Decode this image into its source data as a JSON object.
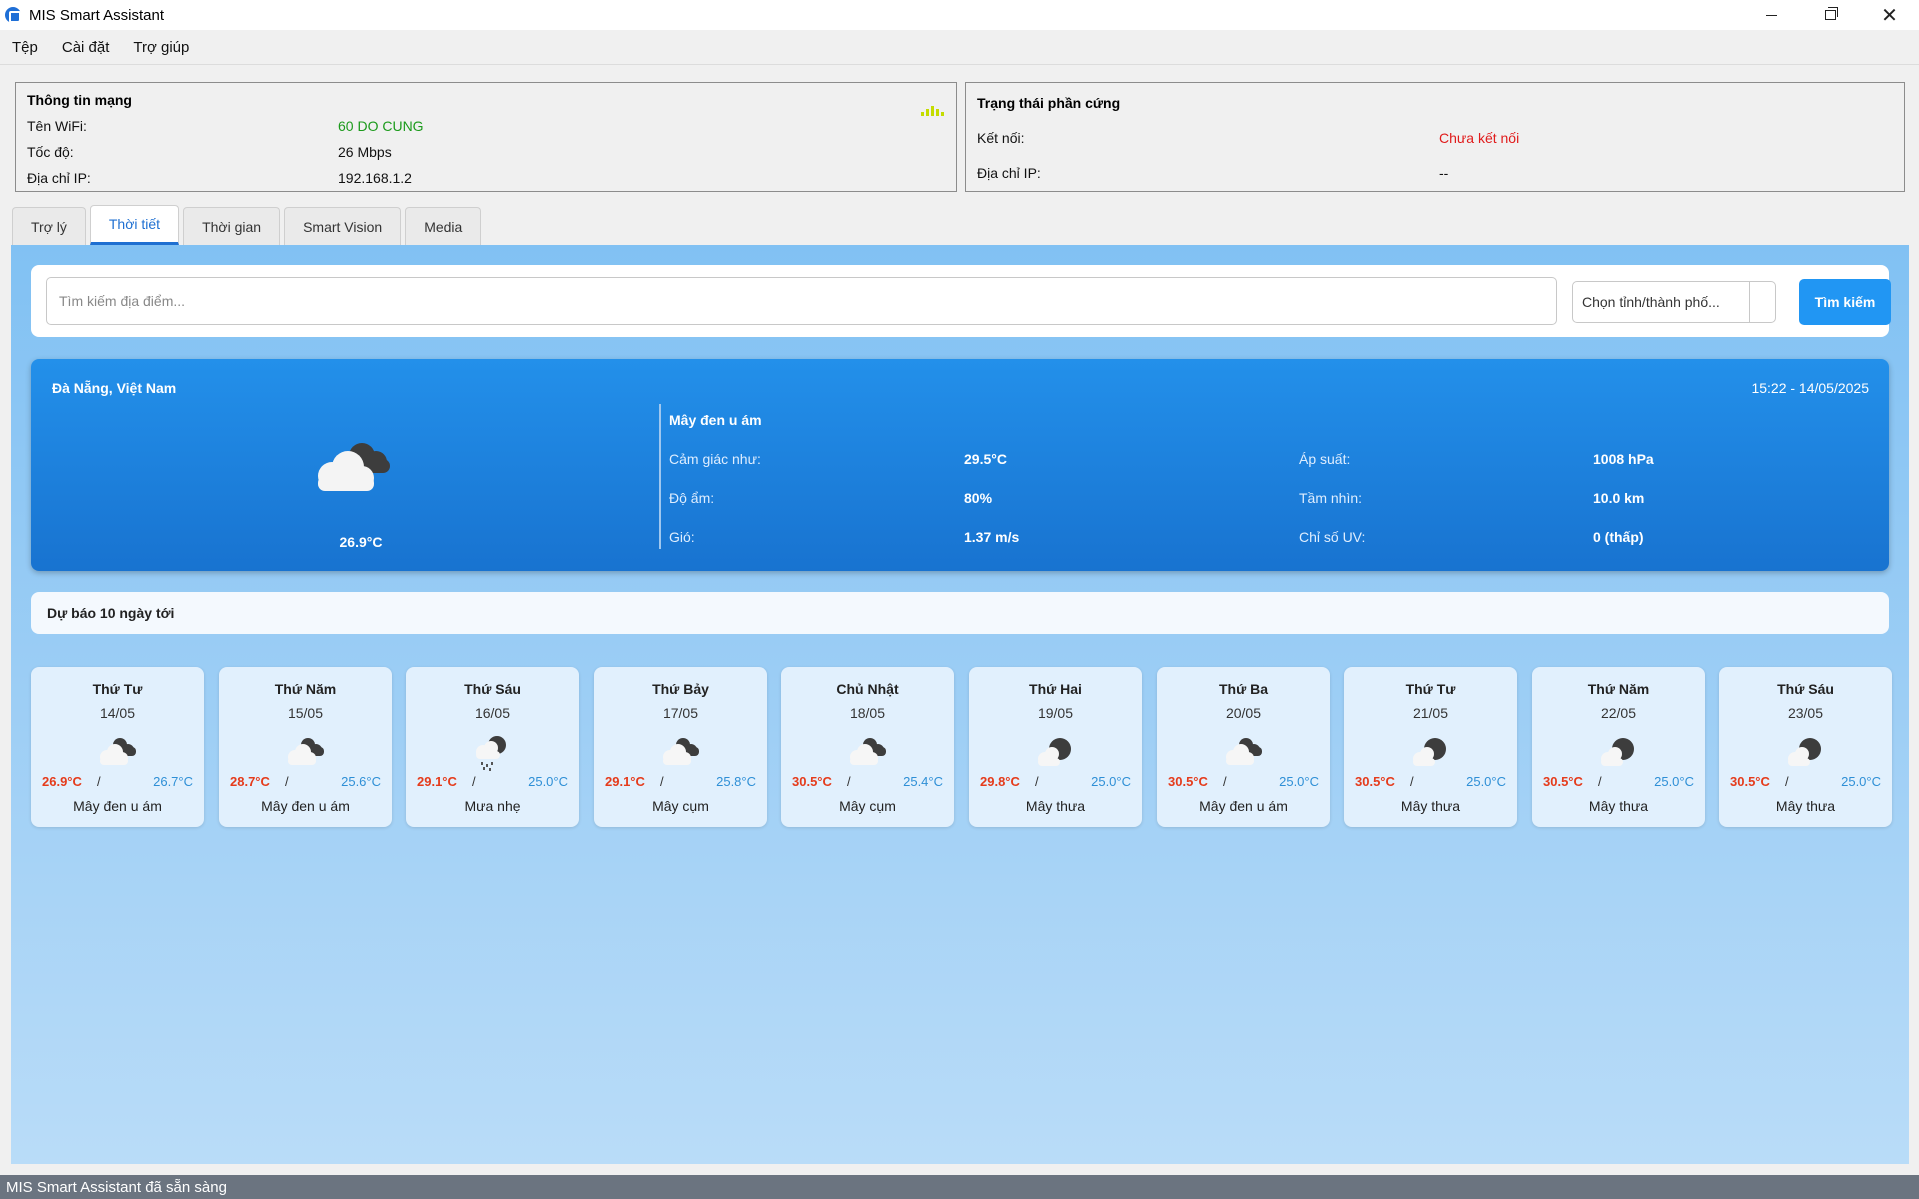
{
  "window": {
    "title": "MIS Smart Assistant"
  },
  "menu": [
    "Tệp",
    "Cài đặt",
    "Trợ giúp"
  ],
  "network": {
    "title": "Thông tin mạng",
    "wifi_label": "Tên WiFi:",
    "wifi_value": "60 DO CUNG",
    "speed_label": "Tốc độ:",
    "speed_value": "26 Mbps",
    "ip_label": "Địa chỉ IP:",
    "ip_value": "192.168.1.2"
  },
  "hardware": {
    "title": "Trạng thái phần cứng",
    "conn_label": "Kết nối:",
    "conn_value": "Chưa kết nối",
    "ip_label": "Địa chỉ IP:",
    "ip_value": "--"
  },
  "tabs": [
    "Trợ lý",
    "Thời tiết",
    "Thời gian",
    "Smart Vision",
    "Media"
  ],
  "search": {
    "placeholder": "Tìm kiếm địa điểm...",
    "city_select": "Chọn tỉnh/thành phố...",
    "button": "Tìm kiếm"
  },
  "current": {
    "location": "Đà Nẵng, Việt Nam",
    "datetime": "15:22 - 14/05/2025",
    "temp": "26.9°C",
    "description": "Mây đen u ám",
    "details": {
      "feels_label": "Cảm giác như:",
      "feels_value": "29.5°C",
      "humidity_label": "Độ ẩm:",
      "humidity_value": "80%",
      "wind_label": "Gió:",
      "wind_value": "1.37 m/s",
      "pressure_label": "Áp suất:",
      "pressure_value": "1008 hPa",
      "visibility_label": "Tầm nhìn:",
      "visibility_value": "10.0 km",
      "uv_label": "Chỉ số UV:",
      "uv_value": "0 (thấp)"
    }
  },
  "forecast": {
    "header": "Dự báo 10 ngày tới",
    "days": [
      {
        "day": "Thứ Tư",
        "date": "14/05",
        "max": "26.9°C",
        "min": "26.7°C",
        "desc": "Mây đen u ám",
        "icon": "overcast-cloud-icon"
      },
      {
        "day": "Thứ Năm",
        "date": "15/05",
        "max": "28.7°C",
        "min": "25.6°C",
        "desc": "Mây đen u ám",
        "icon": "overcast-cloud-icon"
      },
      {
        "day": "Thứ Sáu",
        "date": "16/05",
        "max": "29.1°C",
        "min": "25.0°C",
        "desc": "Mưa nhẹ",
        "icon": "light-rain-icon"
      },
      {
        "day": "Thứ Bảy",
        "date": "17/05",
        "max": "29.1°C",
        "min": "25.8°C",
        "desc": "Mây cụm",
        "icon": "broken-cloud-icon"
      },
      {
        "day": "Chủ Nhật",
        "date": "18/05",
        "max": "30.5°C",
        "min": "25.4°C",
        "desc": "Mây cụm",
        "icon": "broken-cloud-icon"
      },
      {
        "day": "Thứ Hai",
        "date": "19/05",
        "max": "29.8°C",
        "min": "25.0°C",
        "desc": "Mây thưa",
        "icon": "scattered-cloud-icon"
      },
      {
        "day": "Thứ Ba",
        "date": "20/05",
        "max": "30.5°C",
        "min": "25.0°C",
        "desc": "Mây đen u ám",
        "icon": "overcast-cloud-icon"
      },
      {
        "day": "Thứ Tư",
        "date": "21/05",
        "max": "30.5°C",
        "min": "25.0°C",
        "desc": "Mây thưa",
        "icon": "scattered-cloud-icon"
      },
      {
        "day": "Thứ Năm",
        "date": "22/05",
        "max": "30.5°C",
        "min": "25.0°C",
        "desc": "Mây thưa",
        "icon": "scattered-cloud-icon"
      },
      {
        "day": "Thứ Sáu",
        "date": "23/05",
        "max": "30.5°C",
        "min": "25.0°C",
        "desc": "Mây thưa",
        "icon": "scattered-cloud-icon"
      }
    ]
  },
  "status": "MIS Smart Assistant đã sẵn sàng",
  "colors": {
    "accent": "#2196f3",
    "max_temp": "#e53b1b",
    "min_temp": "#2e8fd6",
    "card": "#1e82e0"
  }
}
